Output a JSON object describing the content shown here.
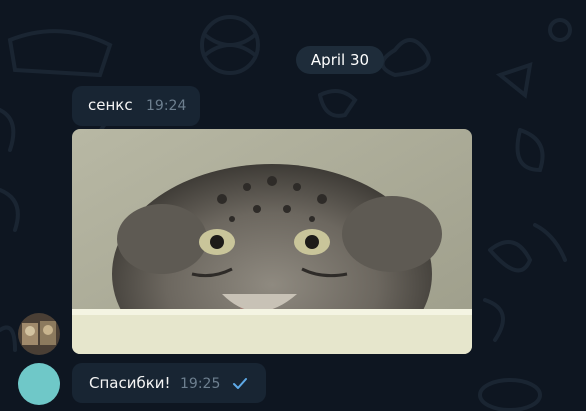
{
  "chat": {
    "date_separator": "April 30",
    "messages": [
      {
        "text": "сенкс",
        "time": "19:24"
      },
      {
        "text": "Спасибки!",
        "time": "19:25"
      }
    ],
    "photo_icon": "cat-photo",
    "read_icon": "check-icon"
  },
  "colors": {
    "background": "#0e1621",
    "bubble": "#182533",
    "date_pill": "#1e2c3a",
    "time_text": "#6d7f8f",
    "check": "#5ea9e6",
    "avatar_teal": "#6fc8c8"
  }
}
